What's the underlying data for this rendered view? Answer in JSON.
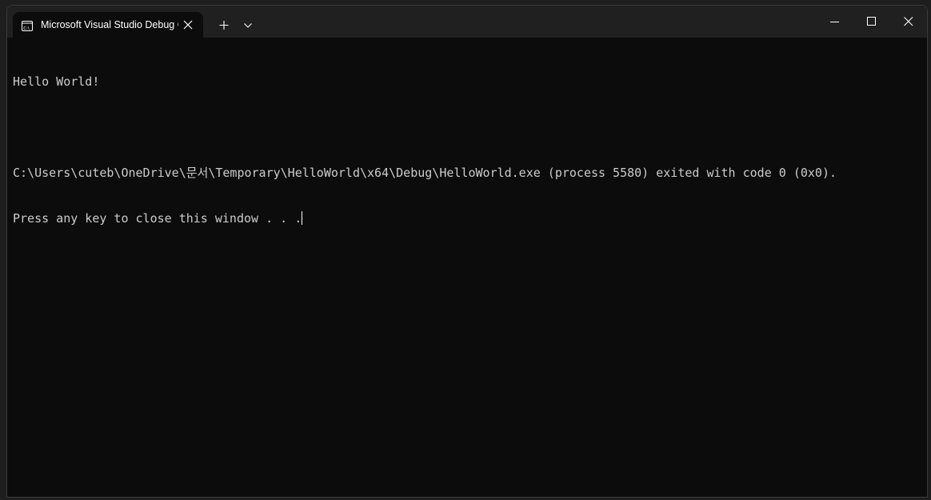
{
  "window": {
    "tab_title": "Microsoft Visual Studio Debug Console",
    "tab_icon": "console-app-icon",
    "new_tab_icon": "plus-icon",
    "dropdown_icon": "chevron-down-icon",
    "controls": {
      "minimize_icon": "minimize-icon",
      "maximize_icon": "maximize-icon",
      "close_icon": "close-icon"
    }
  },
  "terminal": {
    "lines": [
      "Hello World!",
      "",
      "C:\\Users\\cuteb\\OneDrive\\문서\\Temporary\\HelloWorld\\x64\\Debug\\HelloWorld.exe (process 5580) exited with code 0 (0x0).",
      "Press any key to close this window . . ."
    ]
  },
  "colors": {
    "terminal_background": "#0c0c0c",
    "terminal_text": "#cccccc",
    "titlebar": "#202020",
    "tab_title_text": "#ffffff"
  }
}
